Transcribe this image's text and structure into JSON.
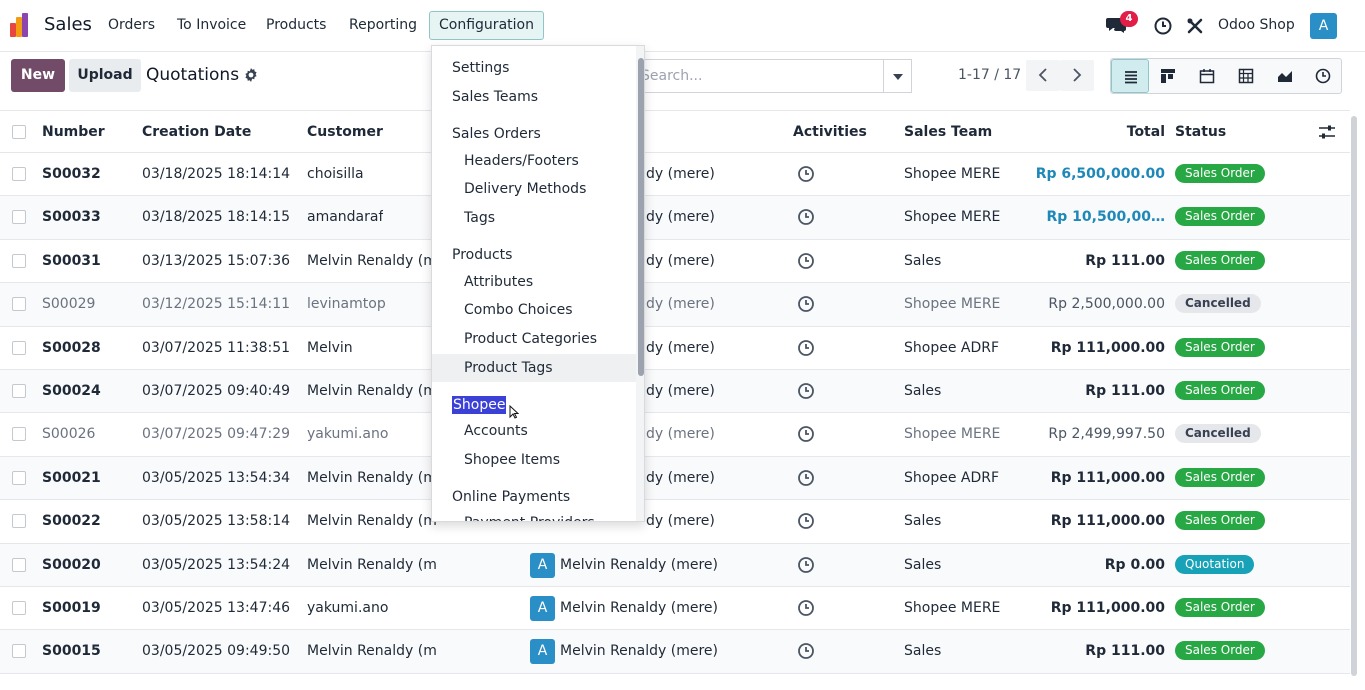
{
  "navbar": {
    "app_name": "Sales",
    "menu": [
      "Orders",
      "To Invoice",
      "Products",
      "Reporting"
    ],
    "active_menu": "Configuration",
    "chat_count": "4",
    "company": "Odoo Shop",
    "user_initial": "A"
  },
  "control": {
    "new_label": "New",
    "upload_label": "Upload",
    "title": "Quotations",
    "search_placeholder": "Search...",
    "pager": "1-17 / 17"
  },
  "table": {
    "headers": {
      "number": "Number",
      "creation_date": "Creation Date",
      "customer": "Customer",
      "activities": "Activities",
      "sales_team": "Sales Team",
      "total": "Total",
      "status": "Status"
    },
    "rows": [
      {
        "number": "S00032",
        "date": "03/18/2025 18:14:14",
        "customer": "choisilla",
        "salesperson": "dy (mere)",
        "team": "Shopee MERE",
        "total": "Rp 6,500,000.00",
        "status": "Sales Order"
      },
      {
        "number": "S00033",
        "date": "03/18/2025 18:14:15",
        "customer": "amandaraf",
        "salesperson": "dy (mere)",
        "team": "Shopee MERE",
        "total": "Rp 10,500,00…",
        "status": "Sales Order"
      },
      {
        "number": "S00031",
        "date": "03/13/2025 15:07:36",
        "customer": "Melvin Renaldy (m",
        "salesperson": "dy (mere)",
        "team": "Sales",
        "total": "Rp 111.00",
        "status": "Sales Order"
      },
      {
        "number": "S00029",
        "date": "03/12/2025 15:14:11",
        "customer": "levinamtop",
        "salesperson": "dy (mere)",
        "team": "Shopee MERE",
        "total": "Rp 2,500,000.00",
        "status": "Cancelled"
      },
      {
        "number": "S00028",
        "date": "03/07/2025 11:38:51",
        "customer": "Melvin",
        "salesperson": "dy (mere)",
        "team": "Shopee ADRF",
        "total": "Rp 111,000.00",
        "status": "Sales Order"
      },
      {
        "number": "S00024",
        "date": "03/07/2025 09:40:49",
        "customer": "Melvin Renaldy (m",
        "salesperson": "dy (mere)",
        "team": "Sales",
        "total": "Rp 111.00",
        "status": "Sales Order"
      },
      {
        "number": "S00026",
        "date": "03/07/2025 09:47:29",
        "customer": "yakumi.ano",
        "salesperson": "dy (mere)",
        "team": "Shopee MERE",
        "total": "Rp 2,499,997.50",
        "status": "Cancelled"
      },
      {
        "number": "S00021",
        "date": "03/05/2025 13:54:34",
        "customer": "Melvin Renaldy (m",
        "salesperson": "dy (mere)",
        "team": "Shopee ADRF",
        "total": "Rp 111,000.00",
        "status": "Sales Order"
      },
      {
        "number": "S00022",
        "date": "03/05/2025 13:58:14",
        "customer": "Melvin Renaldy (m",
        "salesperson": "dy (mere)",
        "team": "Sales",
        "total": "Rp 111,000.00",
        "status": "Sales Order"
      },
      {
        "number": "S00020",
        "date": "03/05/2025 13:54:24",
        "customer": "Melvin Renaldy (mere)",
        "salesperson": "Melvin Renaldy (mere)",
        "team": "Sales",
        "total": "Rp 0.00",
        "status": "Quotation"
      },
      {
        "number": "S00019",
        "date": "03/05/2025 13:47:46",
        "customer": "yakumi.ano",
        "salesperson": "Melvin Renaldy (mere)",
        "team": "Shopee MERE",
        "total": "Rp 111,000.00",
        "status": "Sales Order"
      },
      {
        "number": "S00015",
        "date": "03/05/2025 09:49:50",
        "customer": "Melvin Renaldy (mere)",
        "salesperson": "Melvin Renaldy (mere)",
        "team": "Sales",
        "total": "Rp 111.00",
        "status": "Sales Order"
      }
    ]
  },
  "dropdown": {
    "items": [
      {
        "label": "Settings",
        "kind": "head"
      },
      {
        "label": "Sales Teams",
        "kind": "head"
      },
      {
        "label": "Sales Orders",
        "kind": "head"
      },
      {
        "label": "Headers/Footers",
        "kind": "sub"
      },
      {
        "label": "Delivery Methods",
        "kind": "sub"
      },
      {
        "label": "Tags",
        "kind": "sub"
      },
      {
        "label": "Products",
        "kind": "head"
      },
      {
        "label": "Attributes",
        "kind": "sub"
      },
      {
        "label": "Combo Choices",
        "kind": "sub"
      },
      {
        "label": "Product Categories",
        "kind": "sub"
      },
      {
        "label": "Product Tags",
        "kind": "sub"
      },
      {
        "label": "Shopee",
        "kind": "head"
      },
      {
        "label": "Accounts",
        "kind": "sub"
      },
      {
        "label": "Shopee Items",
        "kind": "sub"
      },
      {
        "label": "Online Payments",
        "kind": "head"
      },
      {
        "label": "Payment Providers",
        "kind": "sub"
      }
    ]
  },
  "colors": {
    "brand": "#714b67",
    "sales_order": "#28a745",
    "quotation": "#17a2b8",
    "link": "#1e88b8"
  }
}
